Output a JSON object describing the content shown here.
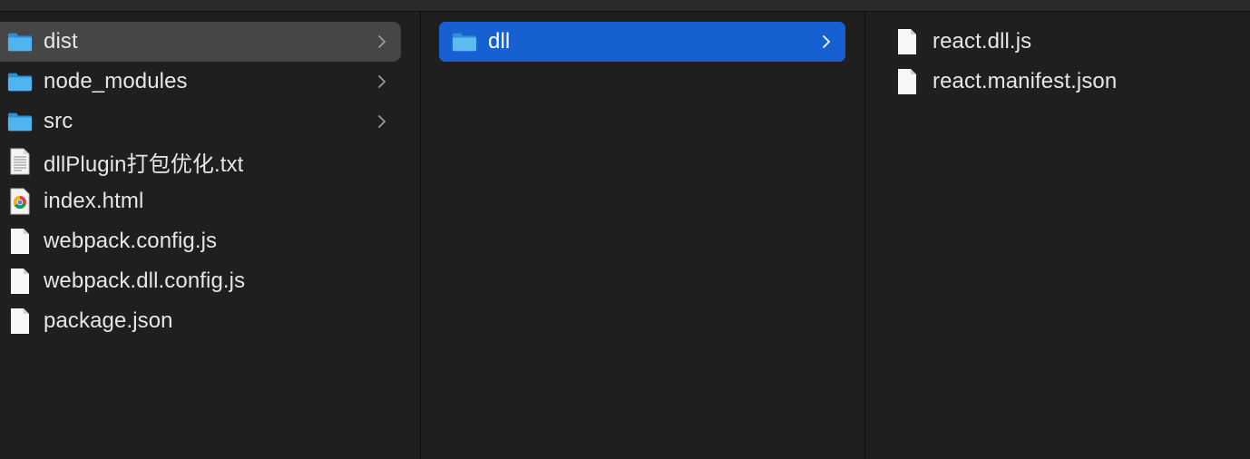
{
  "columns": [
    {
      "items": [
        {
          "label": "dist",
          "icon": "folder-icon",
          "has_children": true,
          "state": "parent-selected"
        },
        {
          "label": "node_modules",
          "icon": "folder-icon",
          "has_children": true,
          "state": "none"
        },
        {
          "label": "src",
          "icon": "folder-icon",
          "has_children": true,
          "state": "none"
        },
        {
          "label": "dllPlugin打包优化.txt",
          "icon": "text-document-icon",
          "has_children": false,
          "state": "none"
        },
        {
          "label": "index.html",
          "icon": "chrome-html-icon",
          "has_children": false,
          "state": "none"
        },
        {
          "label": "webpack.config.js",
          "icon": "blank-file-icon",
          "has_children": false,
          "state": "none"
        },
        {
          "label": "webpack.dll.config.js",
          "icon": "blank-file-icon",
          "has_children": false,
          "state": "none"
        },
        {
          "label": "package.json",
          "icon": "blank-file-icon",
          "has_children": false,
          "state": "none"
        }
      ]
    },
    {
      "items": [
        {
          "label": "dll",
          "icon": "folder-icon",
          "has_children": true,
          "state": "selected"
        }
      ]
    },
    {
      "items": [
        {
          "label": "react.dll.js",
          "icon": "blank-file-icon",
          "has_children": false,
          "state": "none"
        },
        {
          "label": "react.manifest.json",
          "icon": "blank-file-icon",
          "has_children": false,
          "state": "none"
        }
      ]
    }
  ],
  "colors": {
    "background": "#1f1f1f",
    "text": "#e6e6e6",
    "selected_highlight": "#1660d2",
    "parent_highlight": "#464646",
    "folder_blue": "#3aa6e8"
  }
}
